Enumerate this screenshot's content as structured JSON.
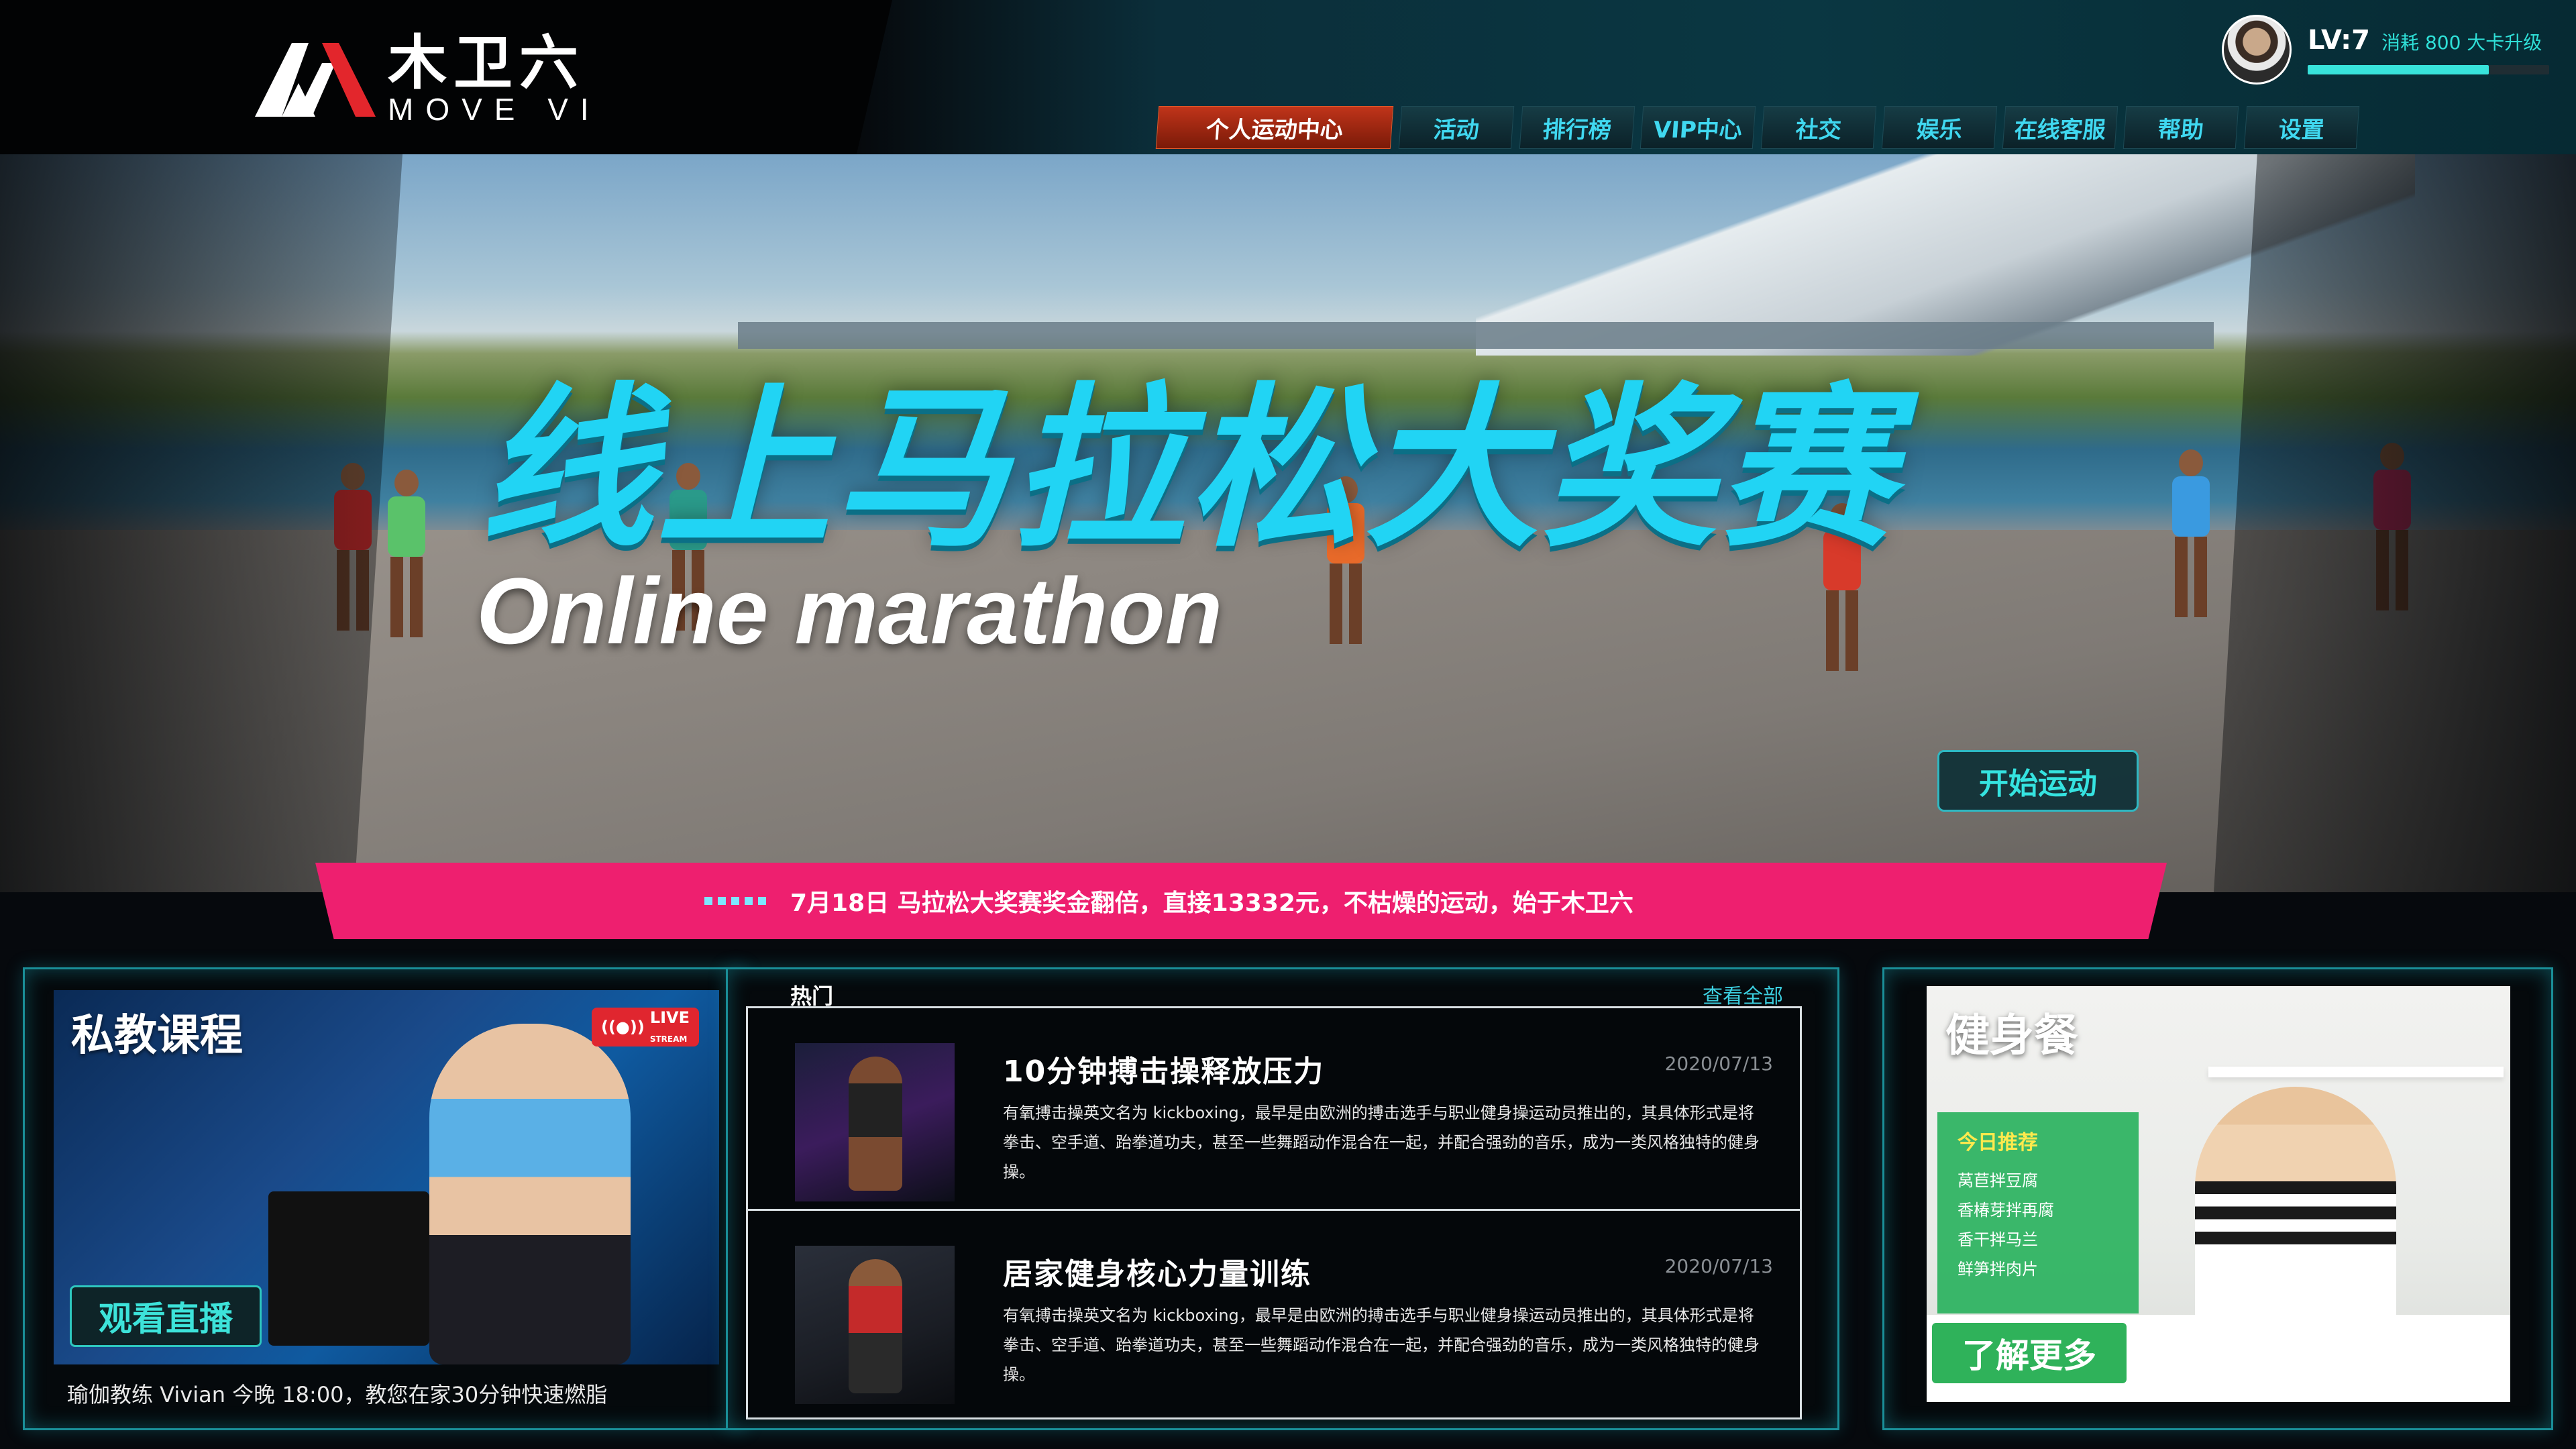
{
  "brand": {
    "logo_text_cn": "木卫六",
    "logo_text_en": "MOVE VI"
  },
  "profile": {
    "level": "LV:7",
    "level_note": "消耗 800 大卡升级",
    "xp_fraction": 0.75
  },
  "nav": {
    "items": [
      {
        "label": "个人运动中心",
        "active": true
      },
      {
        "label": "活动"
      },
      {
        "label": "排行榜"
      },
      {
        "label": "VIP中心"
      },
      {
        "label": "社交"
      },
      {
        "label": "娱乐"
      },
      {
        "label": "在线客服"
      },
      {
        "label": "帮助"
      },
      {
        "label": "设置"
      }
    ]
  },
  "hero": {
    "title_cn": "线上马拉松大奖赛",
    "title_en": "Online marathon",
    "start_button": "开始运动",
    "ticker": "7月18日 马拉松大奖赛奖金翻倍，直接13332元，不枯燥的运动，始于木卫六"
  },
  "course": {
    "title": "私教课程",
    "live_label": "LIVE",
    "live_sub": "STREAM",
    "watch_button": "观看直播",
    "description": "瑜伽教练 Vivian 今晚 18:00，教您在家30分钟快速燃脂"
  },
  "hot": {
    "tag": "热门",
    "view_all": "查看全部",
    "articles": [
      {
        "title": "10分钟搏击操释放压力",
        "date": "2020/07/13",
        "body": "有氧搏击操英文名为 kickboxing，最早是由欧洲的搏击选手与职业健身操运动员推出的，其具体形式是将拳击、空手道、跆拳道功夫，甚至一些舞蹈动作混合在一起，并配合强劲的音乐，成为一类风格独特的健身操。"
      },
      {
        "title": "居家健身核心力量训练",
        "date": "2020/07/13",
        "body": "有氧搏击操英文名为 kickboxing，最早是由欧洲的搏击选手与职业健身操运动员推出的，其具体形式是将拳击、空手道、跆拳道功夫，甚至一些舞蹈动作混合在一起，并配合强劲的音乐，成为一类风格独特的健身操。"
      }
    ]
  },
  "meal": {
    "title": "健身餐",
    "recommend_title": "今日推荐",
    "items": [
      "莴苣拌豆腐",
      "香椿芽拌再腐",
      "香干拌马兰",
      "鲜笋拌肉片"
    ],
    "more_button": "了解更多"
  },
  "colors": {
    "accent": "#21d4f4",
    "ticker": "#ee1f6f",
    "green": "#2fb25a",
    "nav_active": "#c0341a"
  }
}
